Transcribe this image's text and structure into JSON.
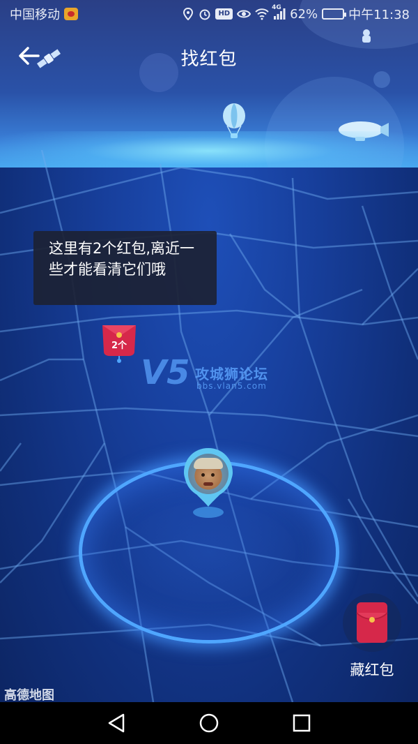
{
  "status_bar": {
    "carrier": "中国移动",
    "network": "4G",
    "battery": "62%",
    "battery_level": 0.62,
    "time": "中午11:38",
    "icons": [
      "weibo-icon",
      "location-icon",
      "alarm-icon",
      "hd-icon",
      "eye-icon",
      "wifi-icon",
      "signal-icon",
      "battery-icon"
    ]
  },
  "header": {
    "title": "找红包",
    "back_icon": "back-arrow-icon"
  },
  "map": {
    "tooltip": "这里有2个红包,离近一些才能看清它们哦",
    "envelope_count": "2个",
    "watermark_title": "攻城狮论坛",
    "watermark_url": "bbs.vlan5.com",
    "watermark_logo": "V5",
    "provider": "高德地图"
  },
  "actions": {
    "hide_red_envelope_label": "藏红包"
  },
  "colors": {
    "accent_red": "#d6284a",
    "circle_blue": "#4fa6ff",
    "map_bg": "#173f9c"
  },
  "nav_bar": {
    "icons": [
      "back-triangle-icon",
      "home-circle-icon",
      "recents-square-icon"
    ]
  }
}
